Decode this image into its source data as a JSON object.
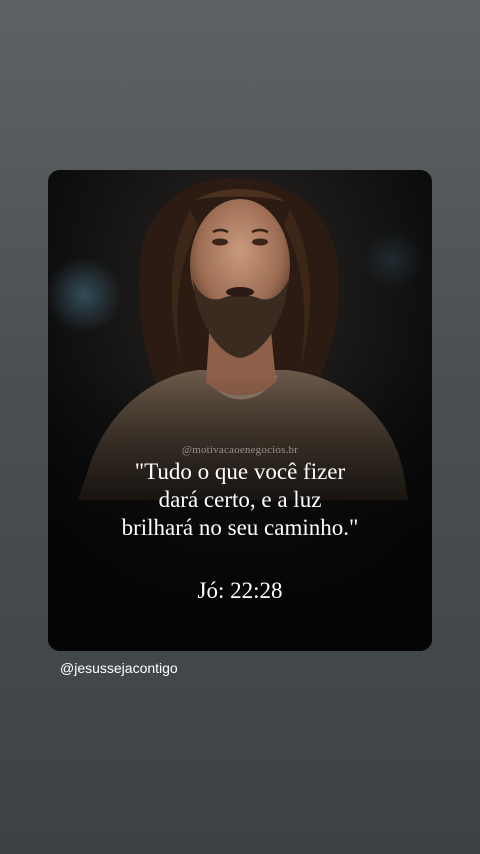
{
  "post": {
    "watermark": "@motivacaoenegocios.br",
    "quote_lines": [
      "\"Tudo o que você fizer",
      "dará certo, e a luz",
      "brilhará no seu caminho.\""
    ],
    "reference": "Jó: 22:28",
    "image_subject": "portrait-of-bearded-man-looking-up"
  },
  "story": {
    "username": "@jesussejacontigo"
  },
  "colors": {
    "background": "#4a4f51",
    "card_background": "#050505",
    "text": "#ffffff"
  }
}
